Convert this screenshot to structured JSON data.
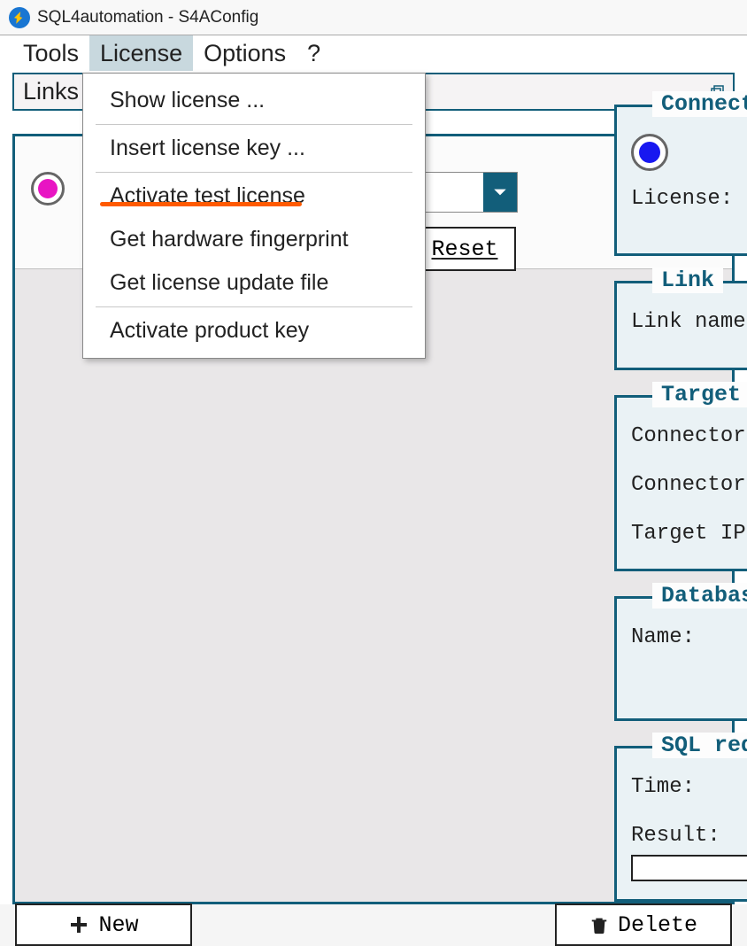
{
  "titlebar": {
    "title": "SQL4automation - S4AConfig"
  },
  "menubar": {
    "tools": "Tools",
    "license": "License",
    "options": "Options",
    "help": "?"
  },
  "license_menu": {
    "show_license": "Show license ...",
    "insert_license_key": "Insert license key ...",
    "activate_test_license": "Activate test license",
    "get_hardware_fingerprint": "Get hardware fingerprint",
    "get_license_update_file": "Get license update file",
    "activate_product_key": "Activate product key"
  },
  "links_panel": {
    "header": "Links",
    "reset_label": "Reset",
    "new_label": "New",
    "delete_label": "Delete"
  },
  "right": {
    "connect": {
      "legend": "Connect",
      "license_label": "License:"
    },
    "link": {
      "legend": "Link",
      "link_name_label": "Link name:"
    },
    "target": {
      "legend": "Target",
      "connector_label_1": "Connector",
      "connector_label_2": "Connector",
      "target_ip_label": "Target IP:"
    },
    "database": {
      "legend": "Databas",
      "name_label": "Name:"
    },
    "sql_req": {
      "legend": "SQL req",
      "time_label": "Time:",
      "result_label": "Result:"
    }
  }
}
